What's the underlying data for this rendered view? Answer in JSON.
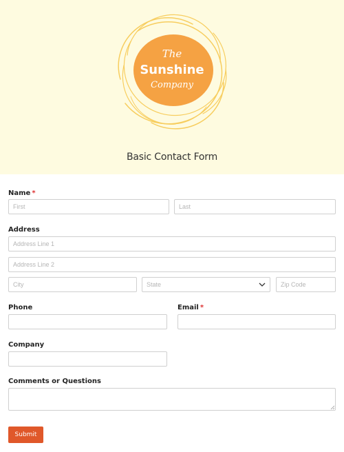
{
  "header": {
    "logo": {
      "line1": "The",
      "line2": "Sunshine",
      "line3": "Company",
      "colors": {
        "sun": "#f5a243",
        "rings": "#f7cd5e"
      }
    },
    "form_title": "Basic Contact Form"
  },
  "form": {
    "name": {
      "label": "Name",
      "required_mark": "*",
      "first_placeholder": "First",
      "last_placeholder": "Last"
    },
    "address": {
      "label": "Address",
      "line1_placeholder": "Address Line 1",
      "line2_placeholder": "Address Line 2",
      "city_placeholder": "City",
      "state_selected": "State",
      "zip_placeholder": "Zip Code"
    },
    "phone": {
      "label": "Phone"
    },
    "email": {
      "label": "Email",
      "required_mark": "*"
    },
    "company": {
      "label": "Company"
    },
    "comments": {
      "label": "Comments or Questions"
    },
    "submit_label": "Submit"
  },
  "colors": {
    "header_bg": "#fefbe0",
    "accent": "#e0582a",
    "required": "#dd3333"
  }
}
